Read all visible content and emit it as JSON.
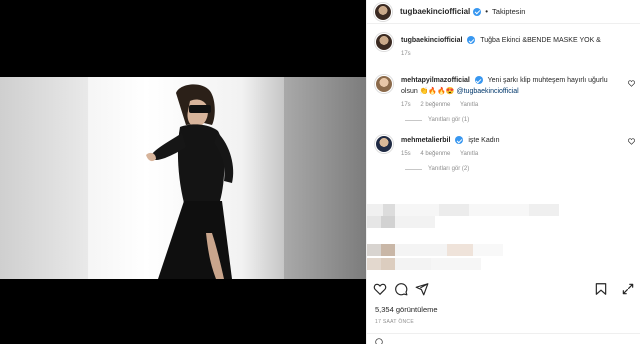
{
  "post": {
    "username": "tugbaekinciofficial",
    "separator": "•",
    "follow_label": "Takiptesin",
    "caption_text": "Tuğba Ekinci &BENDE MASKE YOK &",
    "caption_time": "17s"
  },
  "comments": [
    {
      "username": "mehtapyilmazofficial",
      "text": "Yeni şarkı klip muhteşem hayırlı uğurlu olsun 👏🔥🔥😍",
      "mention": "@tugbaekinciofficial",
      "time": "17s",
      "likes": "2 beğenme",
      "reply": "Yanıtla",
      "view_replies": "Yanıtları gör (1)"
    },
    {
      "username": "mehmetalierbil",
      "text": "işte Kadın",
      "time": "15s",
      "likes": "4 beğenme",
      "reply": "Yanıtla",
      "view_replies": "Yanıtları gör (2)"
    }
  ],
  "stats": {
    "views": "5,354 görüntüleme",
    "ago": "17 SAAT ÖNCE"
  },
  "colors": {
    "accent_verified": "#3897f0",
    "mention": "#00376b",
    "muted": "#8e8e8e"
  },
  "icons": [
    "verified-badge-icon",
    "heart-icon",
    "comment-icon",
    "share-icon",
    "save-icon",
    "expand-icon"
  ]
}
